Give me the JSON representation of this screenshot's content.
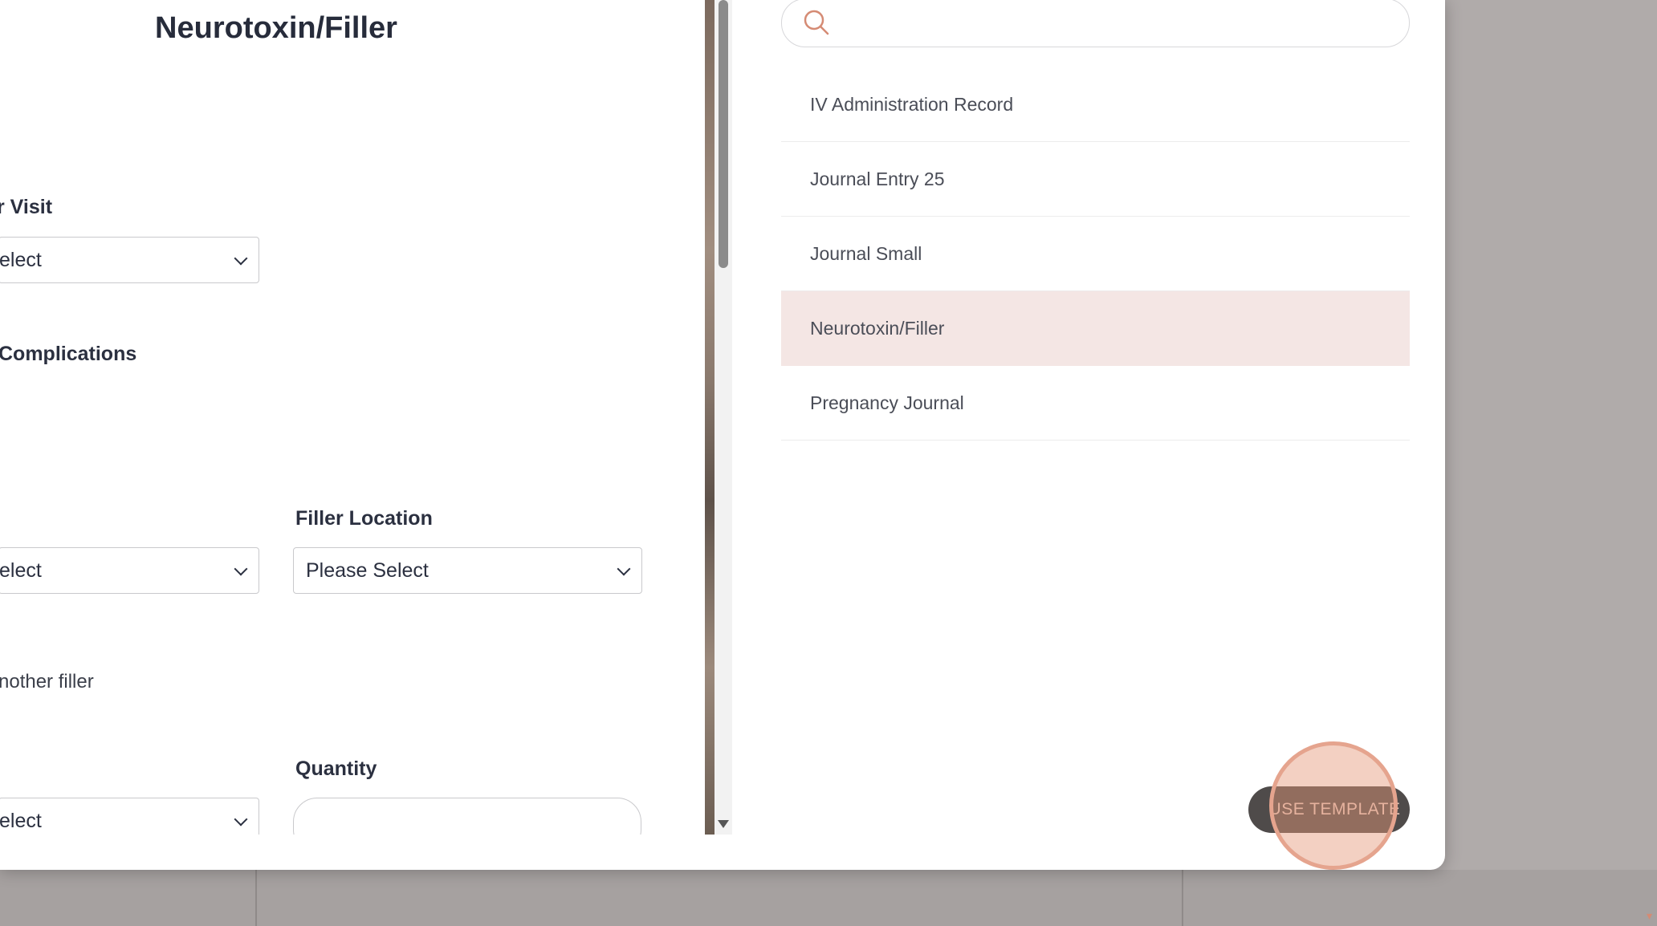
{
  "preview": {
    "title": "Neurotoxin/Filler",
    "fields": {
      "visit_label": "r Visit",
      "visit_select": "elect",
      "complications_label": "Complications",
      "filler_left_select": "elect",
      "filler_location_label": "Filler Location",
      "filler_location_select": "Please Select",
      "another_filler_text": "nother filler",
      "quantity_label": "Quantity",
      "bottom_left_select": "elect"
    }
  },
  "picker": {
    "search": {
      "value": "",
      "placeholder": ""
    },
    "templates": [
      {
        "label": "IV Administration Record",
        "selected": false
      },
      {
        "label": "Journal Entry 25",
        "selected": false
      },
      {
        "label": "Journal Small",
        "selected": false
      },
      {
        "label": "Neurotoxin/Filler",
        "selected": true
      },
      {
        "label": "Pregnancy Journal",
        "selected": false
      }
    ],
    "use_button_label": "USE TEMPLATE"
  },
  "colors": {
    "accent": "#d58b74",
    "selected_row": "#f4e6e4",
    "button_bg": "#4f4b4a",
    "overlay": "#a9a4a2"
  },
  "icons": {
    "search": "search-icon",
    "chevron": "chevron-down-icon"
  }
}
